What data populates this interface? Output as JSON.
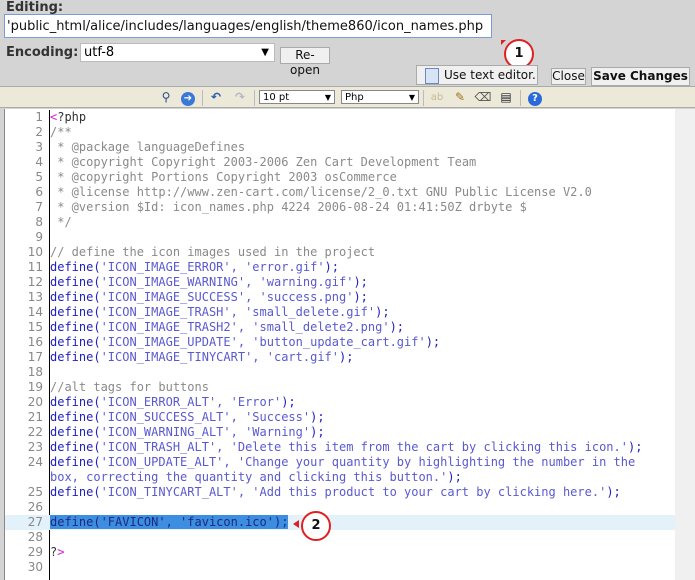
{
  "header": {
    "editing_label": "Editing:",
    "path_value": "'public_html/alice/includes/languages/english/theme860/icon_names.php",
    "encoding_label": "Encoding:",
    "encoding_value": "utf-8",
    "reopen_label": "Re-open",
    "text_editor_label": "Use text editor.",
    "close_label": "Close",
    "save_label": "Save Changes"
  },
  "callouts": {
    "one": "1",
    "two": "2"
  },
  "toolbar": {
    "font_size": "10 pt",
    "syntax": "Php"
  },
  "colors": {
    "keyword": "#2020c0",
    "string": "#5a5ad0",
    "comment": "#8a8a8a",
    "active_line": "#e2f1fa",
    "selection": "#3d8ee0",
    "callout": "#e02020"
  },
  "lines": [
    {
      "n": "1",
      "tokens": [
        {
          "t": "<",
          "c": "tag"
        },
        {
          "t": "?php",
          "c": "def"
        }
      ]
    },
    {
      "n": "2",
      "tokens": [
        {
          "t": "/**",
          "c": "com"
        }
      ]
    },
    {
      "n": "3",
      "tokens": [
        {
          "t": " * @package languageDefines",
          "c": "com"
        }
      ]
    },
    {
      "n": "4",
      "tokens": [
        {
          "t": " * @copyright Copyright 2003-2006 Zen Cart Development Team",
          "c": "com"
        }
      ]
    },
    {
      "n": "5",
      "tokens": [
        {
          "t": " * @copyright Portions Copyright 2003 osCommerce",
          "c": "com"
        }
      ]
    },
    {
      "n": "6",
      "tokens": [
        {
          "t": " * @license http://www.zen-cart.com/license/2_0.txt GNU Public License V2.0",
          "c": "com"
        }
      ]
    },
    {
      "n": "7",
      "tokens": [
        {
          "t": " * @version $Id: icon_names.php 4224 2006-08-24 01:41:50Z drbyte $",
          "c": "com"
        }
      ]
    },
    {
      "n": "8",
      "tokens": [
        {
          "t": " */",
          "c": "com"
        }
      ]
    },
    {
      "n": "9",
      "tokens": []
    },
    {
      "n": "10",
      "tokens": [
        {
          "t": "// define the icon images used in the project",
          "c": "com"
        }
      ]
    },
    {
      "n": "11",
      "tokens": [
        {
          "t": "define(",
          "c": "kw"
        },
        {
          "t": "'ICON_IMAGE_ERROR', 'error.gif'",
          "c": "str"
        },
        {
          "t": ");",
          "c": "kw"
        }
      ]
    },
    {
      "n": "12",
      "tokens": [
        {
          "t": "define(",
          "c": "kw"
        },
        {
          "t": "'ICON_IMAGE_WARNING', 'warning.gif'",
          "c": "str"
        },
        {
          "t": ");",
          "c": "kw"
        }
      ]
    },
    {
      "n": "13",
      "tokens": [
        {
          "t": "define(",
          "c": "kw"
        },
        {
          "t": "'ICON_IMAGE_SUCCESS', 'success.png'",
          "c": "str"
        },
        {
          "t": ");",
          "c": "kw"
        }
      ]
    },
    {
      "n": "14",
      "tokens": [
        {
          "t": "define(",
          "c": "kw"
        },
        {
          "t": "'ICON_IMAGE_TRASH', 'small_delete.gif'",
          "c": "str"
        },
        {
          "t": ");",
          "c": "kw"
        }
      ]
    },
    {
      "n": "15",
      "tokens": [
        {
          "t": "define(",
          "c": "kw"
        },
        {
          "t": "'ICON_IMAGE_TRASH2', 'small_delete2.png'",
          "c": "str"
        },
        {
          "t": ");",
          "c": "kw"
        }
      ]
    },
    {
      "n": "16",
      "tokens": [
        {
          "t": "define(",
          "c": "kw"
        },
        {
          "t": "'ICON_IMAGE_UPDATE', 'button_update_cart.gif'",
          "c": "str"
        },
        {
          "t": ");",
          "c": "kw"
        }
      ]
    },
    {
      "n": "17",
      "tokens": [
        {
          "t": "define(",
          "c": "kw"
        },
        {
          "t": "'ICON_IMAGE_TINYCART', 'cart.gif'",
          "c": "str"
        },
        {
          "t": ");",
          "c": "kw"
        }
      ]
    },
    {
      "n": "18",
      "tokens": []
    },
    {
      "n": "19",
      "tokens": [
        {
          "t": "//alt tags for buttons",
          "c": "com"
        }
      ]
    },
    {
      "n": "20",
      "tokens": [
        {
          "t": "define(",
          "c": "kw"
        },
        {
          "t": "'ICON_ERROR_ALT', 'Error'",
          "c": "str"
        },
        {
          "t": ");",
          "c": "kw"
        }
      ]
    },
    {
      "n": "21",
      "tokens": [
        {
          "t": "define(",
          "c": "kw"
        },
        {
          "t": "'ICON_SUCCESS_ALT', 'Success'",
          "c": "str"
        },
        {
          "t": ");",
          "c": "kw"
        }
      ]
    },
    {
      "n": "22",
      "tokens": [
        {
          "t": "define(",
          "c": "kw"
        },
        {
          "t": "'ICON_WARNING_ALT', 'Warning'",
          "c": "str"
        },
        {
          "t": ");",
          "c": "kw"
        }
      ]
    },
    {
      "n": "23",
      "tokens": [
        {
          "t": "define(",
          "c": "kw"
        },
        {
          "t": "'ICON_TRASH_ALT', 'Delete this item from the cart by clicking this icon.'",
          "c": "str"
        },
        {
          "t": ");",
          "c": "kw"
        }
      ]
    },
    {
      "n": "24",
      "tokens": [
        {
          "t": "define(",
          "c": "kw"
        },
        {
          "t": "'ICON_UPDATE_ALT', 'Change your quantity by highlighting the number in the box, correcting the quantity and clicking this button.'",
          "c": "str"
        },
        {
          "t": ");",
          "c": "kw"
        }
      ]
    },
    {
      "n": "25",
      "tokens": [
        {
          "t": "define(",
          "c": "kw"
        },
        {
          "t": "'ICON_TINYCART_ALT', 'Add this product to your cart by clicking here.'",
          "c": "str"
        },
        {
          "t": ");",
          "c": "kw"
        }
      ]
    },
    {
      "n": "26",
      "tokens": []
    },
    {
      "n": "27",
      "active": true,
      "tokens": [
        {
          "t": "define('FAVICON', 'favicon.ico');",
          "c": "sel"
        }
      ]
    },
    {
      "n": "28",
      "tokens": []
    },
    {
      "n": "29",
      "tokens": [
        {
          "t": "?",
          "c": "def"
        },
        {
          "t": ">",
          "c": "tag"
        }
      ]
    },
    {
      "n": "30",
      "tokens": []
    }
  ]
}
